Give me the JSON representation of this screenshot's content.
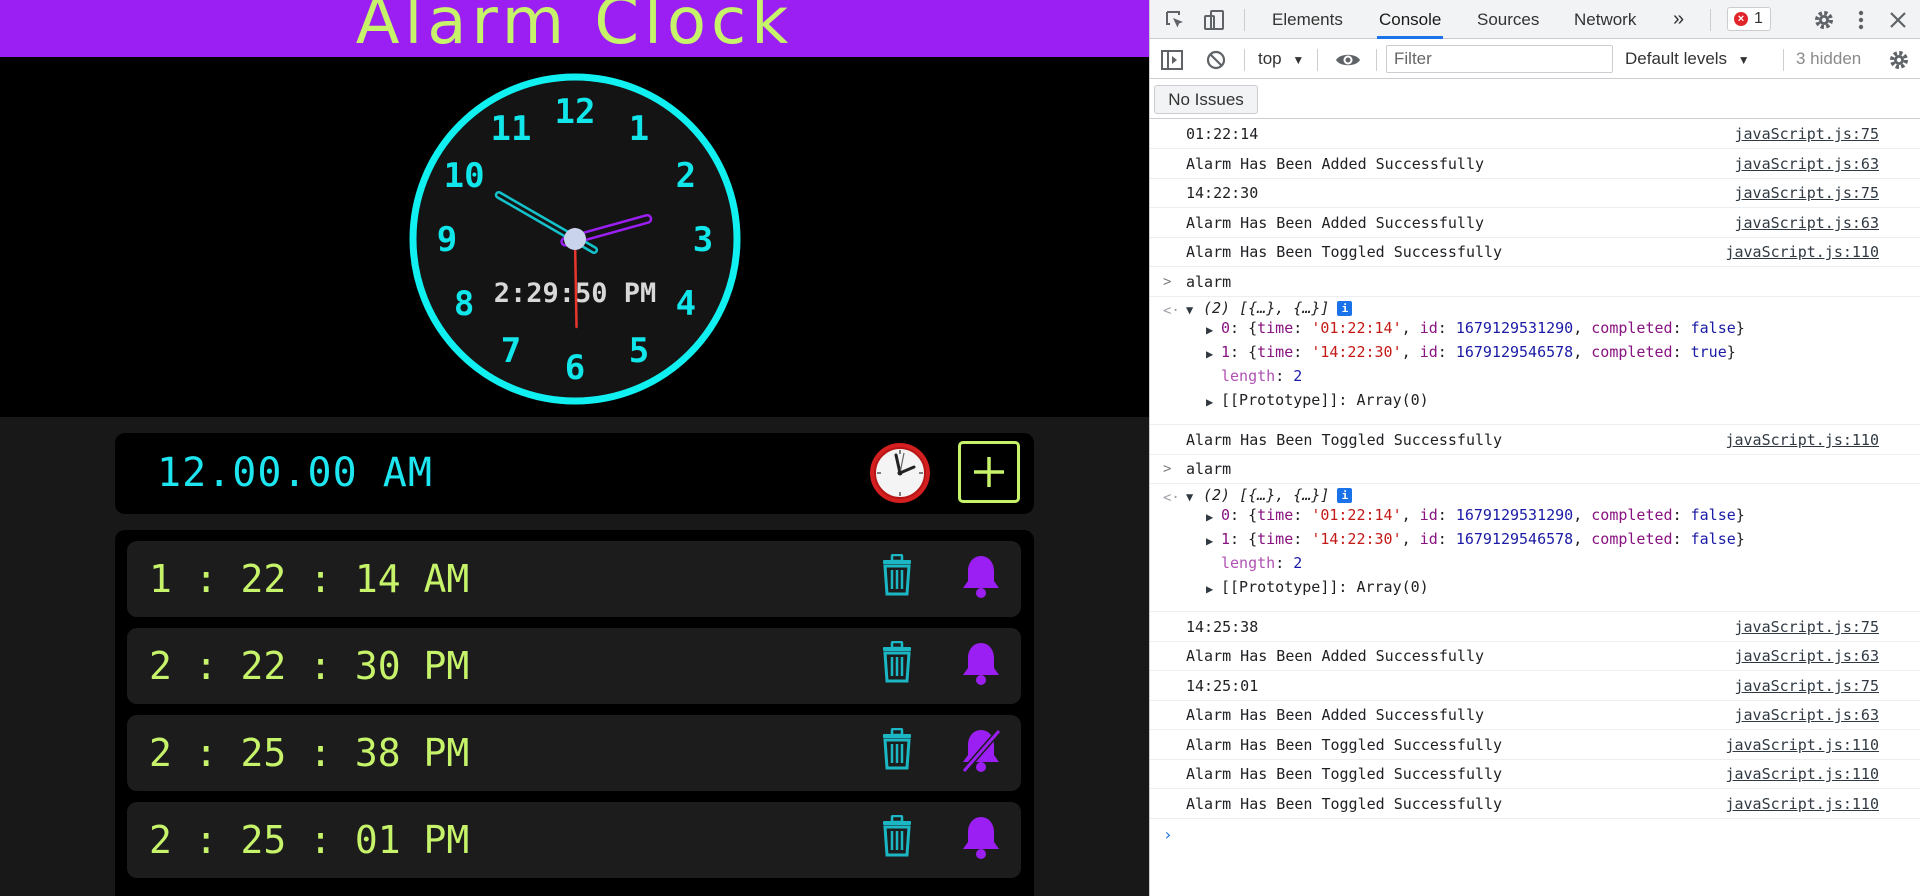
{
  "app": {
    "title": "Alarm Clock",
    "clock": {
      "numbers": [
        "12",
        "1",
        "2",
        "3",
        "4",
        "5",
        "6",
        "7",
        "8",
        "9",
        "10",
        "11"
      ],
      "digital_time": "2:29:50 PM",
      "hands": {
        "hour": 2,
        "minute": 29,
        "second": 50
      }
    },
    "alarm_input": {
      "value": "12.00.00 AM"
    },
    "alarms": [
      {
        "time": "1 : 22 : 14 AM",
        "enabled": true
      },
      {
        "time": "2 : 22 : 30 PM",
        "enabled": true
      },
      {
        "time": "2 : 25 : 38 PM",
        "enabled": false
      },
      {
        "time": "2 : 25 : 01 PM",
        "enabled": true
      }
    ],
    "colors": {
      "header": "#9b1ff2",
      "title": "#c6f36a",
      "cyan": "#1ee6f0",
      "lime": "#c6f36a",
      "purple": "#9b1ff2"
    }
  },
  "devtools": {
    "tabs": [
      "Elements",
      "Console",
      "Sources",
      "Network"
    ],
    "active_tab": "Console",
    "more_tabs": "»",
    "error_count": "1",
    "context": "top",
    "filter_placeholder": "Filter",
    "levels": "Default levels",
    "hidden": "3 hidden",
    "issues": "No Issues",
    "console": {
      "l1": {
        "msg": "01:22:14",
        "src": "javaScript.js:75"
      },
      "l2": {
        "msg": "Alarm Has Been Added Successfully",
        "src": "javaScript.js:63"
      },
      "l3": {
        "msg": "14:22:30",
        "src": "javaScript.js:75"
      },
      "l4": {
        "msg": "Alarm Has Been Added Successfully",
        "src": "javaScript.js:63"
      },
      "l5": {
        "msg": "Alarm Has Been Toggled Successfully",
        "src": "javaScript.js:110"
      },
      "cmd1": "alarm",
      "res1": {
        "summary": "(2) [{…}, {…}]",
        "i0": {
          "idx": "0",
          "time": "'01:22:14'",
          "id": "1679129531290",
          "completed": "false"
        },
        "i1": {
          "idx": "1",
          "time": "'14:22:30'",
          "id": "1679129546578",
          "completed": "true"
        },
        "length": "2",
        "proto": "[[Prototype]]: Array(0)"
      },
      "l6": {
        "msg": "Alarm Has Been Toggled Successfully",
        "src": "javaScript.js:110"
      },
      "cmd2": "alarm",
      "res2": {
        "summary": "(2) [{…}, {…}]",
        "i0": {
          "idx": "0",
          "time": "'01:22:14'",
          "id": "1679129531290",
          "completed": "false"
        },
        "i1": {
          "idx": "1",
          "time": "'14:22:30'",
          "id": "1679129546578",
          "completed": "false"
        },
        "length": "2",
        "proto": "[[Prototype]]: Array(0)"
      },
      "l7": {
        "msg": "14:25:38",
        "src": "javaScript.js:75"
      },
      "l8": {
        "msg": "Alarm Has Been Added Successfully",
        "src": "javaScript.js:63"
      },
      "l9": {
        "msg": "14:25:01",
        "src": "javaScript.js:75"
      },
      "l10": {
        "msg": "Alarm Has Been Added Successfully",
        "src": "javaScript.js:63"
      },
      "l11": {
        "msg": "Alarm Has Been Toggled Successfully",
        "src": "javaScript.js:110"
      },
      "l12": {
        "msg": "Alarm Has Been Toggled Successfully",
        "src": "javaScript.js:110"
      },
      "l13": {
        "msg": "Alarm Has Been Toggled Successfully",
        "src": "javaScript.js:110"
      },
      "labels": {
        "time": "time",
        "id": "id",
        "completed": "completed",
        "length": "length"
      }
    }
  }
}
